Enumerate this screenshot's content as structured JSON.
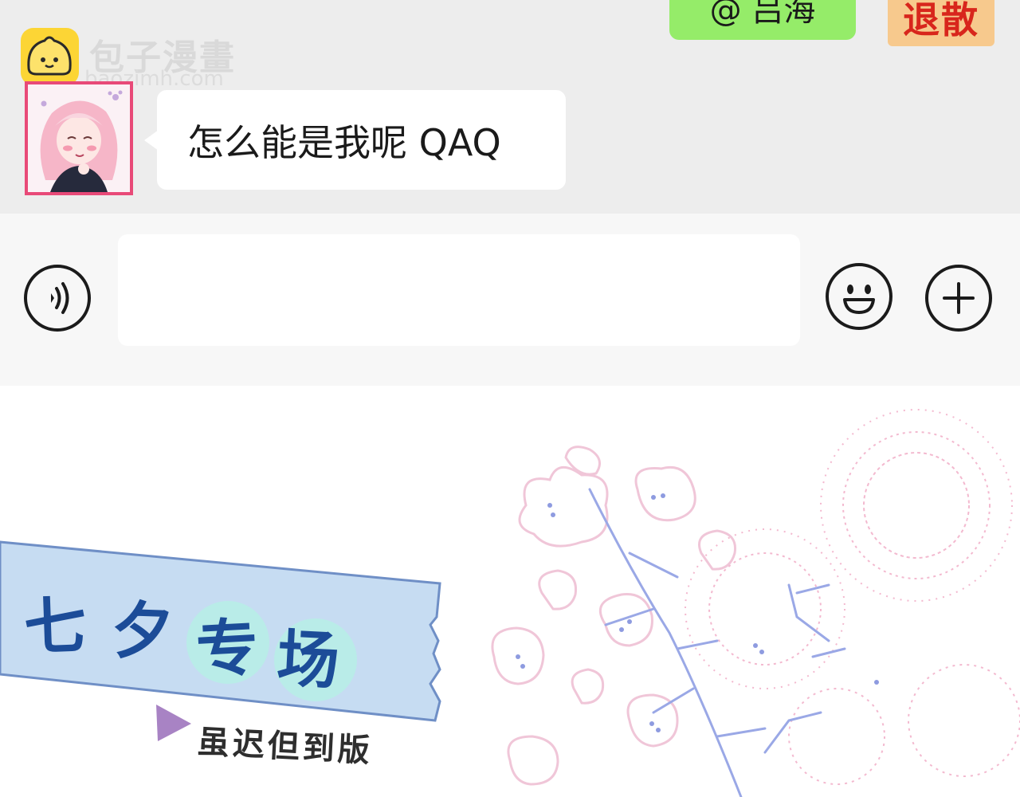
{
  "chat": {
    "sent_message": "@ 吕海",
    "stamp_text": "退散",
    "watermark": {
      "name": "包子漫畫",
      "url": "baozimh.com"
    },
    "received_message": "怎么能是我呢 QAQ"
  },
  "input_bar": {
    "voice_icon": "voice-icon",
    "message_value": "",
    "emoji_icon": "emoji-icon",
    "more_icon": "plus-circle-icon"
  },
  "panel": {
    "title_chars": [
      "七",
      "夕",
      "专",
      "场"
    ],
    "subtitle": "虽迟但到版"
  },
  "colors": {
    "chat_bg": "#ededed",
    "sent_bubble": "#95ec69",
    "stamp_bg": "#f7c98d",
    "stamp_text": "#d8261c",
    "title_blue": "#1c4c98",
    "tape_blue": "#c6dcf2",
    "circle_mint": "#b9ece8",
    "triangle_purple": "#a883c4"
  }
}
